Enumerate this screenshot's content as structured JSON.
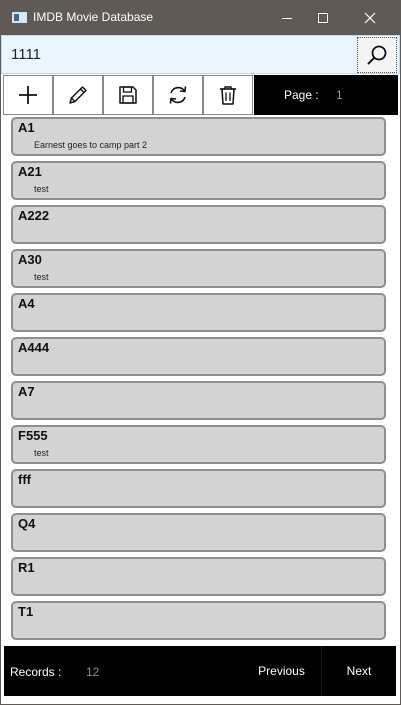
{
  "window": {
    "title": "IMDB Movie Database"
  },
  "search": {
    "value": "1111",
    "icon": "search-icon"
  },
  "toolbar": {
    "buttons": [
      {
        "name": "add-button",
        "icon": "plus-icon"
      },
      {
        "name": "edit-button",
        "icon": "pencil-icon"
      },
      {
        "name": "save-button",
        "icon": "floppy-disk-icon"
      },
      {
        "name": "refresh-button",
        "icon": "refresh-icon"
      },
      {
        "name": "delete-button",
        "icon": "trash-icon"
      }
    ],
    "page_label": "Page :",
    "page_number": "1"
  },
  "items": [
    {
      "title": "A1",
      "subtitle": "Earnest goes to camp part 2"
    },
    {
      "title": "A21",
      "subtitle": "test"
    },
    {
      "title": "A222",
      "subtitle": ""
    },
    {
      "title": "A30",
      "subtitle": "test"
    },
    {
      "title": "A4",
      "subtitle": ""
    },
    {
      "title": "A444",
      "subtitle": ""
    },
    {
      "title": "A7",
      "subtitle": ""
    },
    {
      "title": "F555",
      "subtitle": "test"
    },
    {
      "title": "fff",
      "subtitle": ""
    },
    {
      "title": "Q4",
      "subtitle": ""
    },
    {
      "title": "R1",
      "subtitle": ""
    },
    {
      "title": "T1",
      "subtitle": ""
    }
  ],
  "footer": {
    "records_label": "Records :",
    "records_count": "12",
    "previous_label": "Previous",
    "next_label": "Next"
  },
  "colors": {
    "titlebar": "#5f5a55",
    "search_bg": "#eaf6ff",
    "item_bg": "#d3d3d3",
    "item_border": "#8f8f8f",
    "bar_bg": "#000000"
  }
}
